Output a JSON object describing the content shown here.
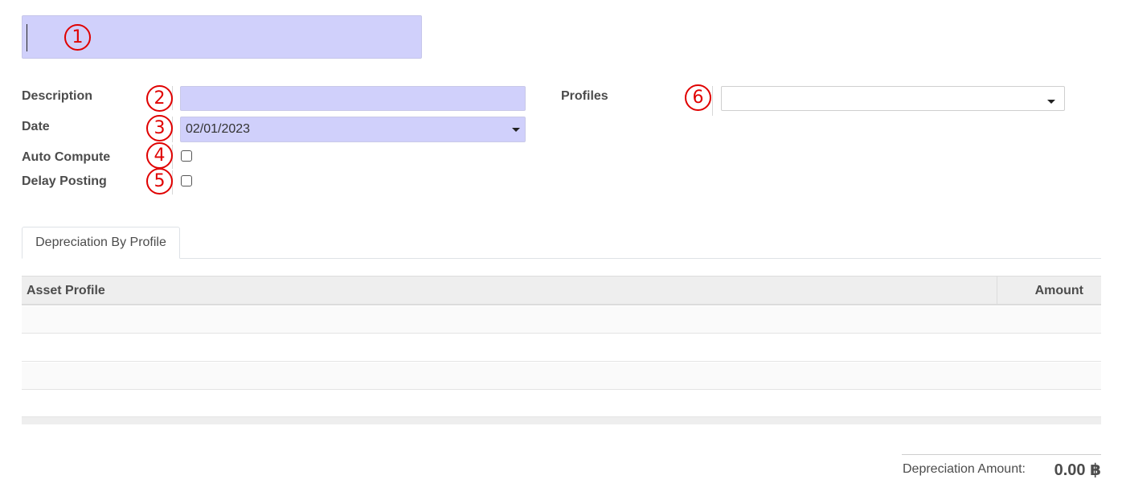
{
  "form": {
    "title_value": "",
    "fields": {
      "description": {
        "label": "Description",
        "value": ""
      },
      "date": {
        "label": "Date",
        "value": "02/01/2023"
      },
      "auto_compute": {
        "label": "Auto Compute",
        "checked": false
      },
      "delay_posting": {
        "label": "Delay Posting",
        "checked": false
      },
      "profiles": {
        "label": "Profiles",
        "value": ""
      }
    }
  },
  "markers": [
    "1",
    "2",
    "3",
    "4",
    "5",
    "6"
  ],
  "tabs": [
    {
      "label": "Depreciation By Profile",
      "active": true
    }
  ],
  "table": {
    "columns": [
      "Asset Profile",
      "Amount"
    ],
    "rows": []
  },
  "totals": {
    "label": "Depreciation Amount:",
    "value": "0.00 ฿"
  },
  "colors": {
    "required_field_bg": "#d0d0fb",
    "marker": "#e00000",
    "table_header_bg": "#eeeeee"
  },
  "icons": [
    "dropdown-caret-icon",
    "dropdown-caret-icon"
  ]
}
